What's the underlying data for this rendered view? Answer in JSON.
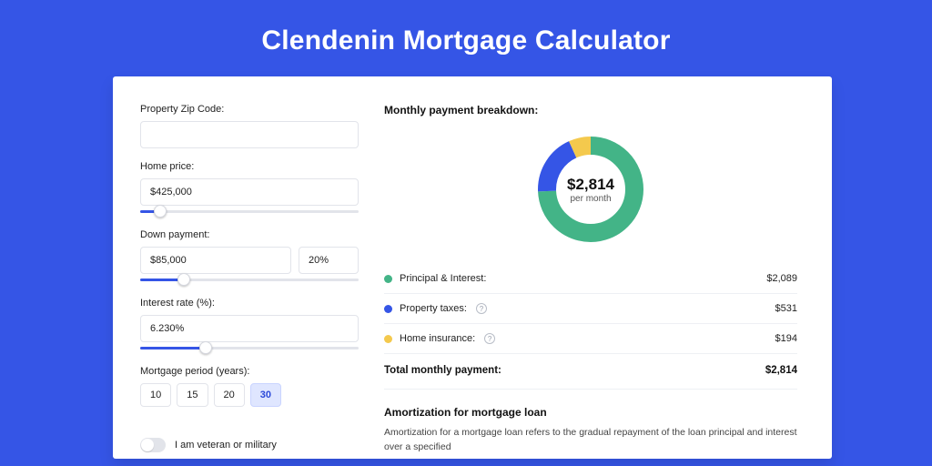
{
  "title": "Clendenin Mortgage Calculator",
  "colors": {
    "principal": "#43b487",
    "taxes": "#3555e6",
    "insurance": "#f4c94d"
  },
  "form": {
    "zip_label": "Property Zip Code:",
    "zip_value": "",
    "home_price_label": "Home price:",
    "home_price_value": "$425,000",
    "home_price_slider_pct": 9,
    "down_payment_label": "Down payment:",
    "down_payment_value": "$85,000",
    "down_payment_pct": "20%",
    "down_payment_slider_pct": 20,
    "interest_label": "Interest rate (%):",
    "interest_value": "6.230%",
    "interest_slider_pct": 30,
    "period_label": "Mortgage period (years):",
    "period_options": [
      "10",
      "15",
      "20",
      "30"
    ],
    "period_active_index": 3,
    "veteran_label": "I am veteran or military",
    "veteran_on": false
  },
  "breakdown": {
    "section_title": "Monthly payment breakdown:",
    "center_value": "$2,814",
    "center_sub": "per month",
    "rows": [
      {
        "label": "Principal & Interest:",
        "value": "$2,089",
        "color_key": "principal",
        "info": false
      },
      {
        "label": "Property taxes:",
        "value": "$531",
        "color_key": "taxes",
        "info": true
      },
      {
        "label": "Home insurance:",
        "value": "$194",
        "color_key": "insurance",
        "info": true
      }
    ],
    "total_label": "Total monthly payment:",
    "total_value": "$2,814"
  },
  "amortization": {
    "title": "Amortization for mortgage loan",
    "text": "Amortization for a mortgage loan refers to the gradual repayment of the loan principal and interest over a specified"
  },
  "chart_data": {
    "type": "pie",
    "title": "Monthly payment breakdown",
    "series": [
      {
        "name": "Principal & Interest",
        "value": 2089,
        "color": "#43b487"
      },
      {
        "name": "Property taxes",
        "value": 531,
        "color": "#3555e6"
      },
      {
        "name": "Home insurance",
        "value": 194,
        "color": "#f4c94d"
      }
    ],
    "total": 2814,
    "center_label": "$2,814 per month"
  }
}
